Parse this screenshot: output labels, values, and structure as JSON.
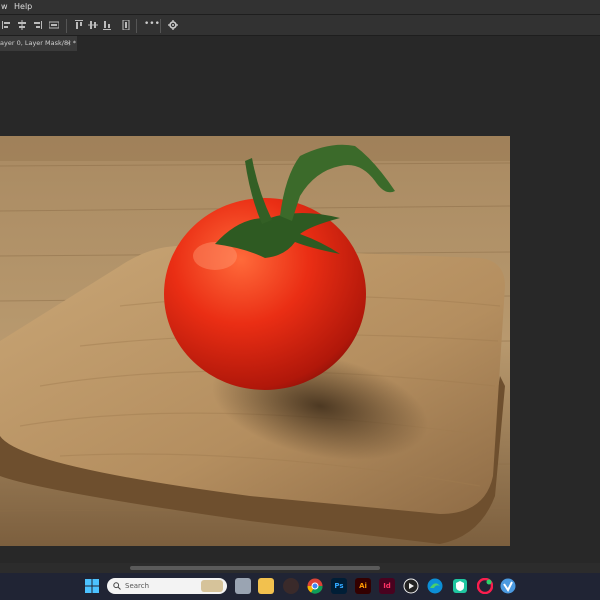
{
  "menu": {
    "items": [
      "w",
      "Help"
    ]
  },
  "options_bar": {
    "icons": [
      "align-left-icon",
      "align-center-icon",
      "align-right-icon",
      "distribute-icon",
      "align-top-icon",
      "align-middle-icon",
      "align-bottom-icon",
      "distribute-vertical-icon",
      "more-icon",
      "gear-icon"
    ],
    "more_label": "•••"
  },
  "document_tab": {
    "title": "ayer 0, Layer Mask/8) *",
    "close": "×"
  },
  "canvas": {
    "image": "red cherry tomato on wooden cutting board"
  },
  "taskbar": {
    "search_placeholder": "Search",
    "apps": [
      "Windows Start",
      "File Explorer",
      "Task View",
      "Folder",
      "App",
      "Chrome",
      "Photoshop",
      "Illustrator",
      "InDesign",
      "Media",
      "Edge",
      "Defender",
      "Opera GX",
      "Vivaldi"
    ],
    "labels": {
      "ps": "Ps",
      "ai": "Ai",
      "id": "Id"
    }
  }
}
